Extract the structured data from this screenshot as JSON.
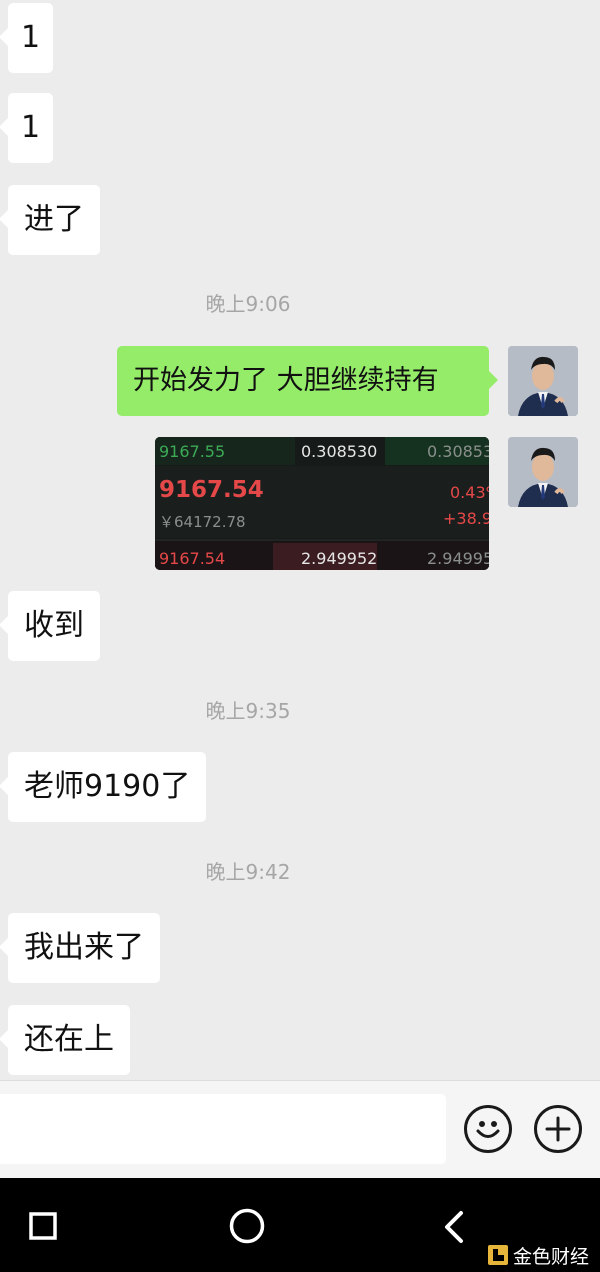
{
  "messages": [
    {
      "text": "1"
    },
    {
      "text": "1"
    },
    {
      "text": "进了"
    },
    {
      "time": "晚上9:06"
    },
    {
      "text": "开始发力了 大胆继续持有"
    },
    {
      "image": {
        "row1": [
          "9167.55",
          "0.308530",
          "0.30853"
        ],
        "price": "9167.54",
        "cny": "￥64172.78",
        "pct": "0.43%",
        "change": "+38.9",
        "row3": [
          "9167.54",
          "2.949952",
          "2.94995"
        ]
      }
    },
    {
      "text": "收到"
    },
    {
      "time": "晚上9:35"
    },
    {
      "text": "老师9190了"
    },
    {
      "time": "晚上9:42"
    },
    {
      "text": "我出来了"
    },
    {
      "text": "还在上"
    }
  ],
  "input": {
    "placeholder": ""
  },
  "icons": {
    "emoji": "emoji-icon",
    "plus": "plus-icon",
    "recent_apps": "square-icon",
    "home": "circle-icon",
    "back": "back-chevron-icon",
    "watermark_logo": "jinse-logo-icon"
  },
  "watermark": "金色财经",
  "colors": {
    "background": "#ececec",
    "outgoing_bubble": "#95ec69",
    "incoming_bubble": "#ffffff",
    "timestamp": "#a6a6a6",
    "nav_bar": "#000000",
    "watermark_logo": "#e8b53b"
  }
}
